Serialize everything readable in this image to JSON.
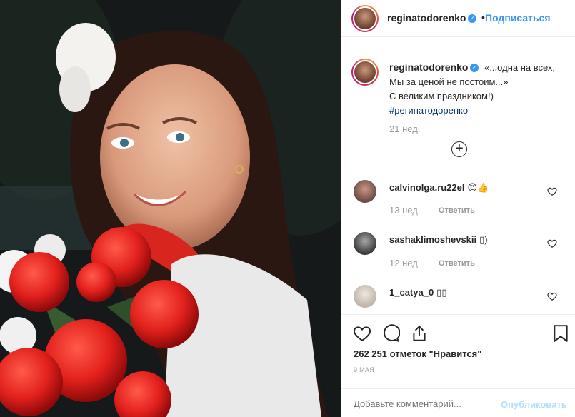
{
  "photo": {
    "alt_icon": "photo-girl-with-roses"
  },
  "header": {
    "username": "reginatodorenko",
    "verified_icon": "verified-badge-icon",
    "separator": "•",
    "follow_label": "Подписаться"
  },
  "caption": {
    "username": "reginatodorenko",
    "line1": "«...одна на всех,",
    "line2": "Мы за ценой не постоим...»",
    "line3": "С великим праздником!)",
    "hashtag": "#регинатодоренко",
    "time": "21 нед.",
    "load_more_icon": "plus-circle-icon"
  },
  "comments": [
    {
      "username": "calvinolga.ru22el",
      "text": "😍👍",
      "time": "13 нед.",
      "reply": "Ответить",
      "avatar_color": "#6b4a44"
    },
    {
      "username": "sashaklimoshevskii",
      "text": "▯)",
      "time": "12 нед.",
      "reply": "Ответить",
      "avatar_color": "#4a4a4a"
    },
    {
      "username": "1_catya_0",
      "text": "▯▯",
      "time": "",
      "reply": "",
      "avatar_color": "#cfc6be"
    }
  ],
  "actions": {
    "likes": "262 251 отметок \"Нравится\"",
    "date": "9 МАЯ",
    "comment_placeholder": "Добавьте комментарий...",
    "publish_label": "Опубликовать"
  },
  "colors": {
    "link": "#3897f0",
    "publish_disabled": "#b2dffc",
    "muted": "#999999"
  }
}
